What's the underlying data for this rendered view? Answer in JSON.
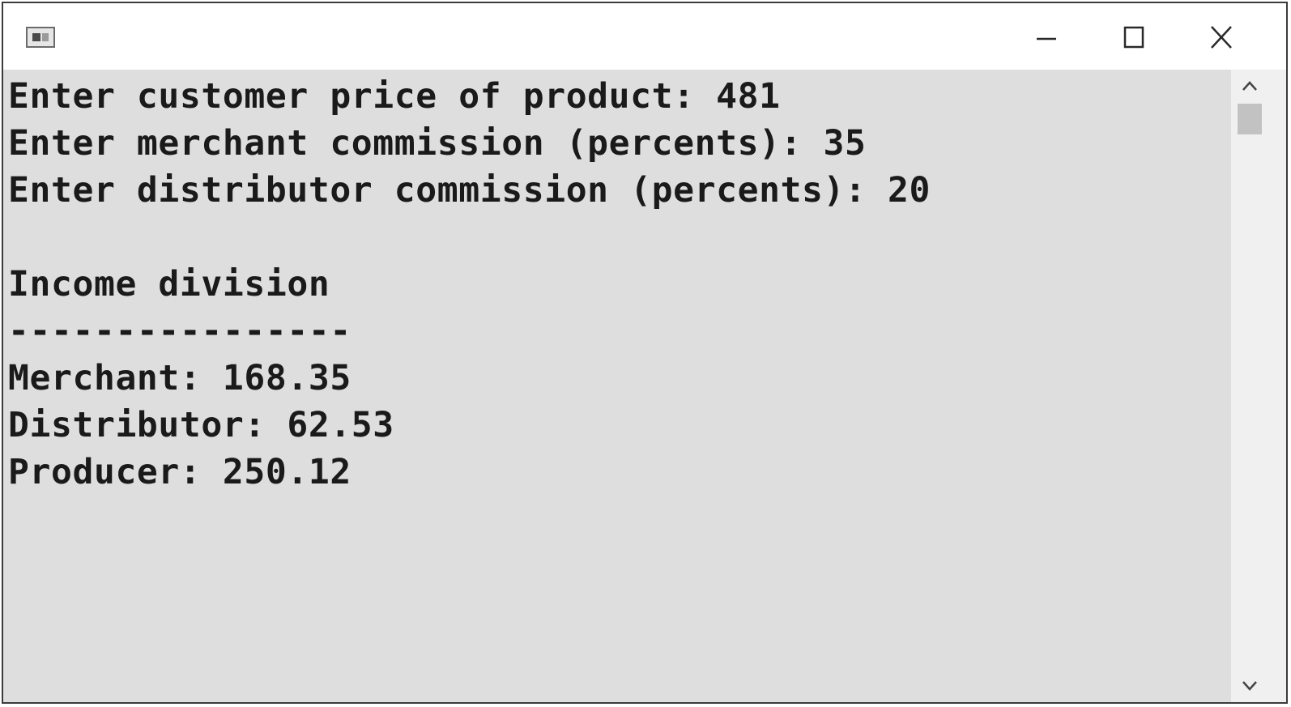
{
  "window": {
    "title_icon": "console-app-icon",
    "controls": {
      "minimize_icon": "minimize-icon",
      "maximize_icon": "maximize-icon",
      "close_icon": "close-icon"
    }
  },
  "console": {
    "lines": [
      "Enter customer price of product: 481",
      "Enter merchant commission (percents): 35",
      "Enter distributor commission (percents): 20",
      "",
      "Income division",
      "----------------",
      "Merchant: 168.35",
      "Distributor: 62.53",
      "Producer: 250.12"
    ],
    "background": "#dedede",
    "text_color": "#1a1a1a"
  },
  "scrollbar": {
    "up_icon": "chevron-up-icon",
    "down_icon": "chevron-down-icon"
  }
}
